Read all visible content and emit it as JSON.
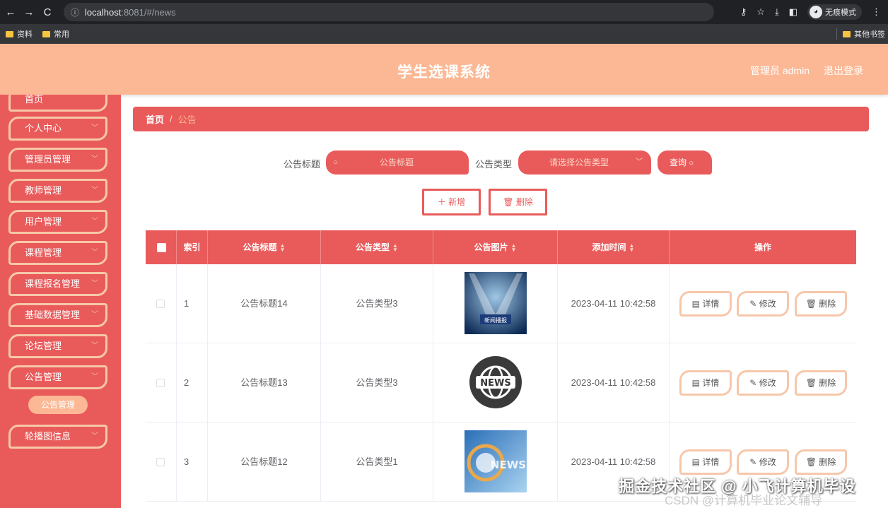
{
  "browser": {
    "url_host": "localhost",
    "url_rest": ":8081/#/news",
    "incognito_label": "无痕模式",
    "bookmarks": [
      "资料",
      "常用"
    ],
    "other_bookmarks": "其他书签"
  },
  "header": {
    "title": "学生选课系统",
    "user": "管理员 admin",
    "logout": "退出登录"
  },
  "sidebar": {
    "items": [
      {
        "label": "首页"
      },
      {
        "label": "个人中心"
      },
      {
        "label": "管理员管理"
      },
      {
        "label": "教师管理"
      },
      {
        "label": "用户管理"
      },
      {
        "label": "课程管理"
      },
      {
        "label": "课程报名管理"
      },
      {
        "label": "基础数据管理"
      },
      {
        "label": "论坛管理"
      },
      {
        "label": "公告管理"
      },
      {
        "label": "轮播图信息"
      }
    ],
    "sub_item": "公告管理"
  },
  "breadcrumb": {
    "home": "首页",
    "separator": "/",
    "current": "公告"
  },
  "search": {
    "title_label": "公告标题",
    "title_placeholder": "公告标题",
    "type_label": "公告类型",
    "type_placeholder": "请选择公告类型",
    "query_button": "查询"
  },
  "actions": {
    "add": "新增",
    "delete": "删除"
  },
  "table": {
    "columns": [
      "索引",
      "公告标题",
      "公告类型",
      "公告图片",
      "添加时间",
      "操作"
    ],
    "rows": [
      {
        "index": "1",
        "title": "公告标题14",
        "type": "公告类型3",
        "image": "stage-news-image",
        "time": "2023-04-11 10:42:58"
      },
      {
        "index": "2",
        "title": "公告标题13",
        "type": "公告类型3",
        "image": "news-globe-badge",
        "time": "2023-04-11 10:42:58"
      },
      {
        "index": "3",
        "title": "公告标题12",
        "type": "公告类型1",
        "image": "blue-news-image",
        "time": "2023-04-11 10:42:58"
      }
    ],
    "row_actions": {
      "detail": "详情",
      "edit": "修改",
      "delete": "删除"
    },
    "image_captions": {
      "row1": "新闻播报",
      "row2": "NEWS",
      "row3": "NEWS"
    }
  },
  "watermark": {
    "main": "掘金技术社区 @ 小飞计算机毕设",
    "sub": "CSDN @计算机毕业论文辅导"
  },
  "colors": {
    "accent": "#e95b5b",
    "header": "#fcb894",
    "border": "#f7c7aa"
  }
}
